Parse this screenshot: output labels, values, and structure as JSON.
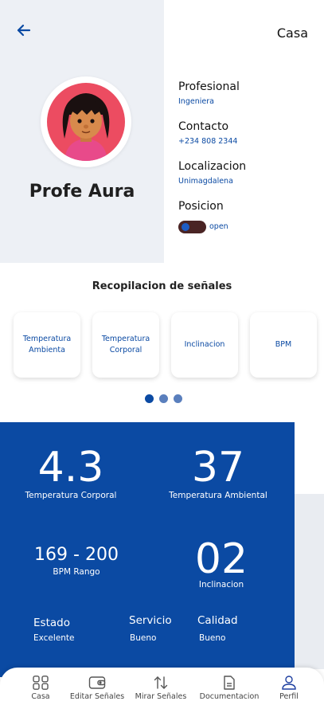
{
  "header": {
    "home_label": "Casa"
  },
  "profile": {
    "name": "Profe Aura",
    "fields": [
      {
        "title": "Profesional",
        "value": "Ingeniera"
      },
      {
        "title": "Contacto",
        "value": "+234 808 2344"
      },
      {
        "title": "Localizacion",
        "value": "Unimagdalena"
      },
      {
        "title": "Posicion",
        "value": "open"
      }
    ],
    "position_toggle_on": true
  },
  "signals": {
    "title": "Recopilacion de señales",
    "cards": [
      {
        "line1": "Temperatura",
        "line2": "Ambienta"
      },
      {
        "line1": "Temperatura",
        "line2": "Corporal"
      },
      {
        "line1": "Inclinacion",
        "line2": ""
      },
      {
        "line1": "BPM",
        "line2": ""
      }
    ],
    "pager": {
      "count": 3,
      "active": 1
    }
  },
  "stats": {
    "corporal_value": "4.3",
    "corporal_label": "Temperatura Corporal",
    "ambiental_value": "37",
    "ambiental_label": "Temperatura Ambiental",
    "bpm_value": "169 - 200",
    "bpm_label": "BPM Rango",
    "inclinacion_value": "02",
    "inclinacion_label": "Inclinacion",
    "estado_title": "Estado",
    "estado_value": "Excelente",
    "servicio_title": "Servicio",
    "servicio_value": "Bueno",
    "calidad_title": "Calidad",
    "calidad_value": "Bueno"
  },
  "nav": [
    {
      "label": "Casa",
      "icon": "grid-icon"
    },
    {
      "label": "Editar Señales",
      "icon": "wallet-icon"
    },
    {
      "label": "Mirar Señales",
      "icon": "arrows-icon"
    },
    {
      "label": "Documentacion",
      "icon": "document-icon"
    },
    {
      "label": "Perfil",
      "icon": "user-icon"
    }
  ],
  "colors": {
    "brand_blue": "#0b4aa3",
    "avatar_bg": "#ec4c61",
    "panel_grey": "#edf0f5",
    "toggle_track": "#4a2424"
  }
}
